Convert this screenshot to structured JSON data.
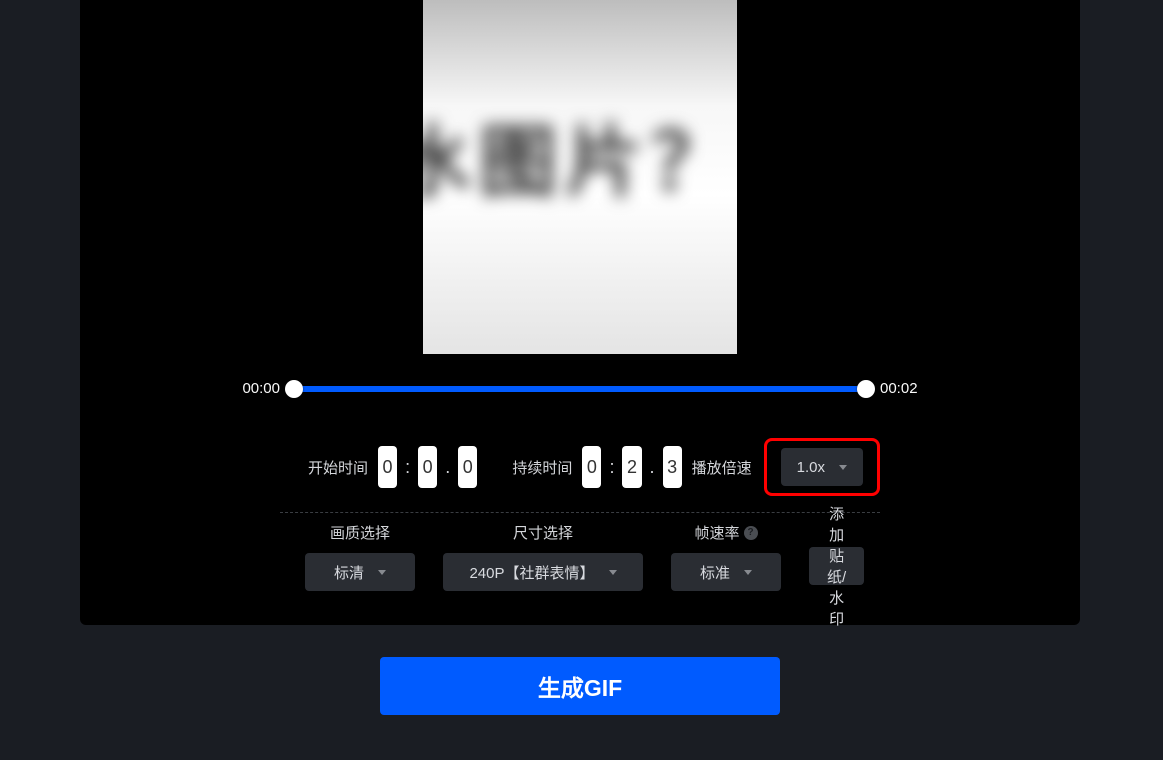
{
  "preview": {
    "blur_text": "水图片？"
  },
  "slider": {
    "start_label": "00:00",
    "end_label": "00:02"
  },
  "start_time": {
    "label": "开始时间",
    "d0": "0",
    "d1": "0",
    "d2": "0"
  },
  "duration": {
    "label": "持续时间",
    "d0": "0",
    "d1": "2",
    "d2": "3"
  },
  "speed": {
    "label": "播放倍速",
    "value": "1.0x"
  },
  "quality": {
    "label": "画质选择",
    "value": "标清"
  },
  "size": {
    "label": "尺寸选择",
    "value": "240P【社群表情】"
  },
  "framerate": {
    "label": "帧速率",
    "value": "标准"
  },
  "watermark": {
    "label": "添加贴纸/水印"
  },
  "generate": {
    "label": "生成GIF"
  }
}
